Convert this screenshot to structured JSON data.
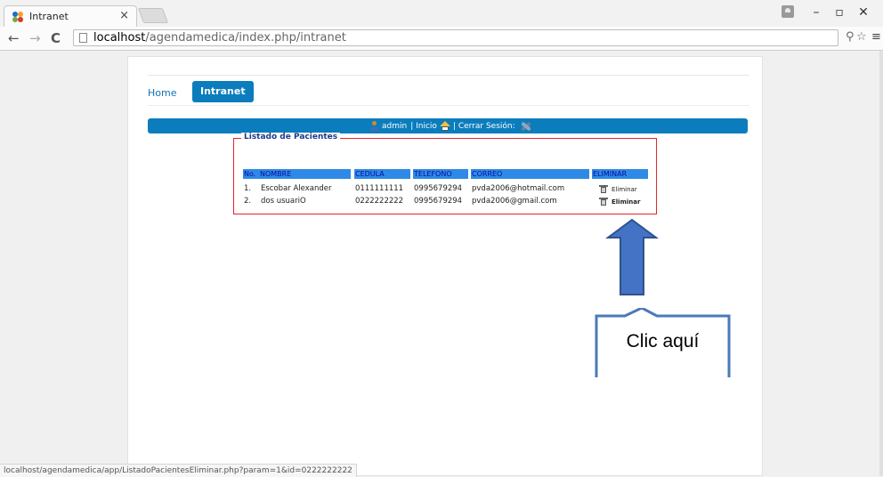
{
  "browser": {
    "tab_title": "Intranet",
    "tab_close": "×",
    "url_host": "localhost",
    "url_path": "/agendamedica/index.php/intranet",
    "back_icon": "arrow-left-icon",
    "forward_icon": "arrow-right-icon",
    "reload_icon": "reload-icon",
    "status_url": "localhost/agendamedica/app/ListadoPacientesEliminar.php?param=1&id=0222222222"
  },
  "nav": {
    "home_label": "Home",
    "intranet_label": "Intranet"
  },
  "userbar": {
    "username": "admin",
    "separator1": "| Inicio",
    "separator2": "| Cerrar Sesión:"
  },
  "list": {
    "legend": "Listado de Pacientes",
    "headers": [
      "No.",
      "NOMBRE",
      "CEDULA",
      "TELEFONO",
      "CORREO",
      "ELIMINAR"
    ],
    "rows": [
      {
        "no": "1.",
        "nombre": "Escobar Alexander",
        "cedula": "0111111111",
        "telefono": "0995679294",
        "correo": "pvda2006@hotmail.com",
        "eliminar": "Eliminar"
      },
      {
        "no": "2.",
        "nombre": "dos usuariO",
        "cedula": "0222222222",
        "telefono": "0995679294",
        "correo": "pvda2006@gmail.com",
        "eliminar": "Eliminar"
      }
    ]
  },
  "annotation": {
    "callout_text": "Clic aquí"
  },
  "colors": {
    "accent": "#0b7dbd",
    "header_bg": "#2e8ae6",
    "fieldset_border": "#e4252b",
    "callout_border": "#4a7ab8",
    "arrow_fill": "#4472c4"
  }
}
